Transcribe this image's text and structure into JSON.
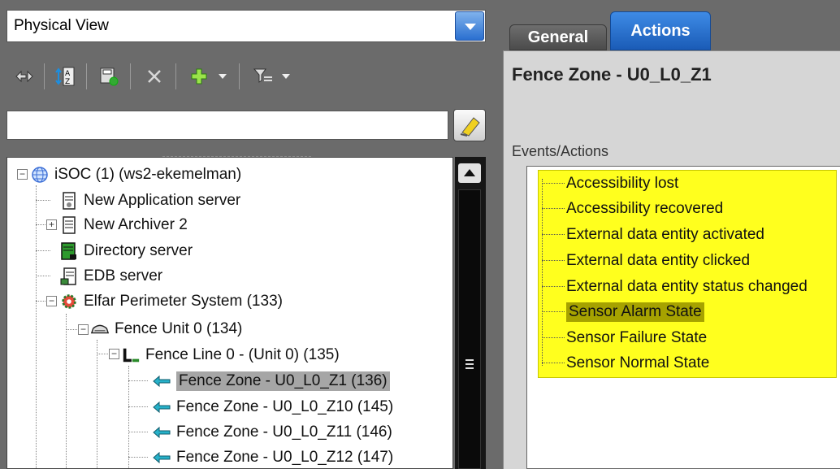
{
  "view_selector": {
    "value": "Physical View"
  },
  "filter": {
    "placeholder": ""
  },
  "tree": {
    "items": [
      {
        "label": "iSOC (1) (ws2-ekemelman)",
        "icon": "globe-icon"
      },
      {
        "label": "New Application server",
        "icon": "app-server-icon"
      },
      {
        "label": "New Archiver 2",
        "icon": "archiver-icon"
      },
      {
        "label": "Directory server",
        "icon": "directory-server-icon"
      },
      {
        "label": "EDB server",
        "icon": "edb-server-icon"
      },
      {
        "label": "Elfar Perimeter System (133)",
        "icon": "perimeter-system-icon"
      },
      {
        "label": "Fence Unit 0 (134)",
        "icon": "fence-unit-icon"
      },
      {
        "label": "Fence Line 0 - (Unit 0) (135)",
        "icon": "fence-line-icon"
      },
      {
        "label": "Fence Zone - U0_L0_Z1 (136)",
        "icon": "fence-zone-icon"
      },
      {
        "label": "Fence Zone - U0_L0_Z10 (145)",
        "icon": "fence-zone-icon"
      },
      {
        "label": "Fence Zone - U0_L0_Z11 (146)",
        "icon": "fence-zone-icon"
      },
      {
        "label": "Fence Zone - U0_L0_Z12 (147)",
        "icon": "fence-zone-icon"
      }
    ]
  },
  "tabs": {
    "general": "General",
    "actions": "Actions"
  },
  "details": {
    "title": "Fence Zone - U0_L0_Z1",
    "events_label": "Events/Actions",
    "events": [
      "Accessibility lost",
      "Accessibility recovered",
      "External data entity activated",
      "External data entity clicked",
      "External data entity status changed",
      "Sensor Alarm State",
      "Sensor Failure State",
      "Sensor Normal State"
    ]
  },
  "colors": {
    "highlight": "#ffff1e",
    "selected_tab": "#2a6fd0",
    "panel": "#6b6b6b"
  }
}
